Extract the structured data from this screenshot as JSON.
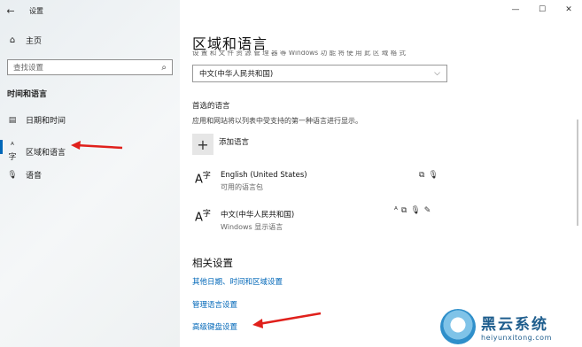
{
  "window": {
    "title": "设置",
    "controls": {
      "minimize": "—",
      "maximize": "☐",
      "close": "✕"
    }
  },
  "sidebar": {
    "back_glyph": "←",
    "home": {
      "label": "主页",
      "icon": "home-icon"
    },
    "search": {
      "placeholder": "查找设置",
      "icon": "search-icon"
    },
    "section_title": "时间和语言",
    "items": [
      {
        "label": "日期和时间",
        "icon": "calendar-clock-icon",
        "active": false
      },
      {
        "label": "区域和语言",
        "icon": "language-icon",
        "active": true
      },
      {
        "label": "语音",
        "icon": "microphone-icon",
        "active": false
      }
    ]
  },
  "main": {
    "title": "区域和语言",
    "cut_text": "设 置 和 文 件 资 源 管 理 器 等 Windows 功 能 将 使 用 此 区 域 格 式",
    "country_dropdown": {
      "value": "中文(中华人民共和国)"
    },
    "preferred": {
      "title": "首选的语言",
      "description": "应用和网站将以列表中受支持的第一种语言进行显示。",
      "add_label": "添加语言",
      "languages": [
        {
          "name": "English (United States)",
          "status": "可用的语言包",
          "features": [
            "display-icon",
            "microphone-icon"
          ]
        },
        {
          "name": "中文(中华人民共和国)",
          "status": "Windows 显示语言",
          "features": [
            "text-to-speech-icon",
            "display-icon",
            "microphone-icon",
            "handwriting-icon"
          ]
        }
      ]
    },
    "related": {
      "title": "相关设置",
      "links": [
        "其他日期、时间和区域设置",
        "管理语言设置",
        "高级键盘设置"
      ]
    }
  },
  "watermark": {
    "brand": "黑云系统",
    "url": "heiyunxitong.com"
  },
  "colors": {
    "accent": "#0067b8",
    "arrow": "#e0201b"
  }
}
